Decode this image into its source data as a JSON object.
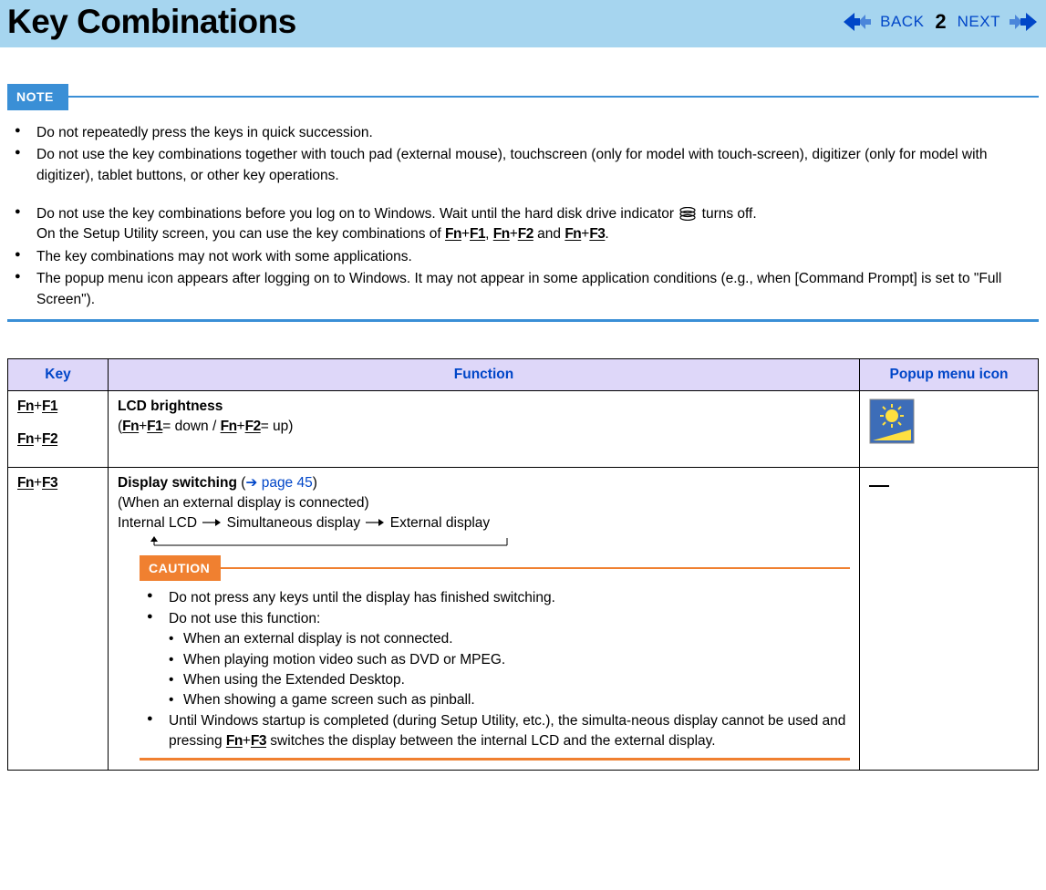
{
  "header": {
    "title": "Key Combinations",
    "back_label": "BACK",
    "next_label": "NEXT",
    "page_number": "2"
  },
  "note": {
    "badge": "NOTE",
    "items": [
      "Do not repeatedly press the keys in quick succession.",
      "Do not use the key combinations together with touch pad (external mouse), touchscreen (only for model with touch-screen), digitizer (only for model with digitizer), tablet buttons, or other key operations."
    ],
    "item3_pre": "Do not use the key combinations before you log on to Windows. Wait until the hard disk drive indicator ",
    "item3_post": " turns off.",
    "item3_line2_pre": "On the Setup Utility screen, you can use the key combinations of ",
    "item3_and1": " and ",
    "item3_period": ".",
    "item4": "The key combinations may not work with some applications.",
    "item5": "The popup menu icon appears after logging on to Windows. It may not appear in some application conditions (e.g., when [Command Prompt] is set to \"Full Screen\")."
  },
  "table": {
    "headers": {
      "key": "Key",
      "function": "Function",
      "icon": "Popup menu icon"
    },
    "row1": {
      "function_title": "LCD brightness",
      "function_detail_pre": "(",
      "function_detail_mid1": "= down / ",
      "function_detail_mid2": "= up)"
    },
    "row2": {
      "function_title": "Display switching",
      "page_ref_pre": " (",
      "page_ref_arrow": "➔",
      "page_ref": " page 45",
      "page_ref_post": ")",
      "subtitle": "(When an external display is connected)",
      "seq1": "Internal LCD",
      "seq2": "Simultaneous display",
      "seq3": "External display",
      "caution_badge": "CAUTION",
      "caution1": "Do not press any keys until the display has finished switching.",
      "caution2": "Do not use this function:",
      "caution2a": "When an external display is not connected.",
      "caution2b": "When playing motion video such as DVD or MPEG.",
      "caution2c": "When using the Extended Desktop.",
      "caution2d": "When showing a game screen such as pinball.",
      "caution3_pre": "Until Windows startup is completed (during Setup Utility, etc.), the simulta-neous display cannot be used and pressing ",
      "caution3_post": " switches the display between the internal LCD and the external display."
    }
  },
  "keys": {
    "fn": "Fn",
    "f1": "F1",
    "f2": "F2",
    "f3": "F3",
    "plus": "+",
    "comma": ", "
  }
}
